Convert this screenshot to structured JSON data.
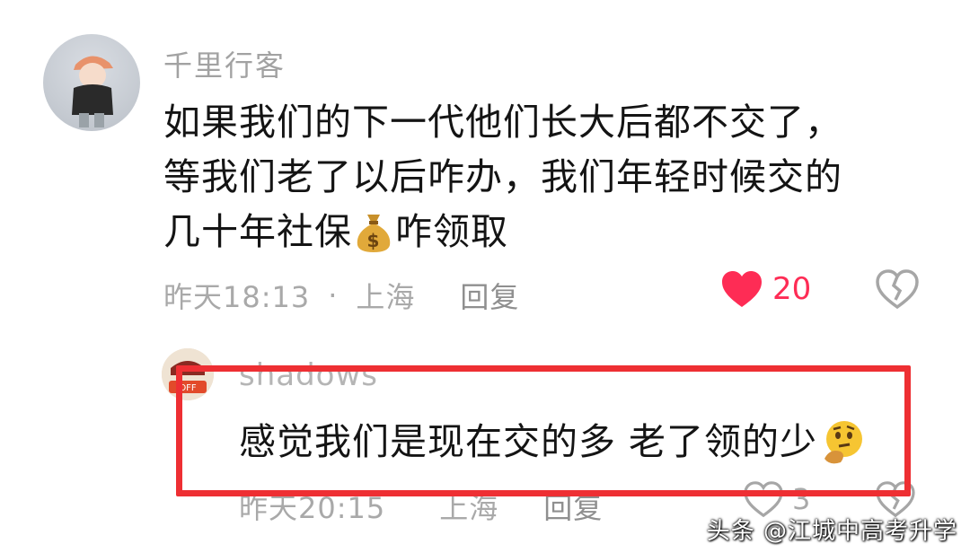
{
  "main_comment": {
    "username": "千里行客",
    "text_line1": "如果我们的下一代他们长大后都不交了，",
    "text_line2": "等我们老了以后咋办，我们年轻时候交的",
    "text_line3_part1": "几十年社保",
    "emoji": "money-bag-emoji",
    "text_line3_part2": "咋领取",
    "time": "昨天18:13",
    "separator": "·",
    "location": "上海",
    "reply_label": "回复",
    "like_count": "20",
    "colors": {
      "like": "#fe2c55"
    }
  },
  "reply_comment": {
    "username": "shadows",
    "text": "感觉我们是现在交的多 老了领的少",
    "emoji": "thinking-face-emoji",
    "time": "昨天20:15",
    "location": "上海",
    "reply_label": "回复",
    "like_count": "3"
  },
  "highlight_color": "#ee2f33",
  "watermark": "头条 @江城中高考升学"
}
